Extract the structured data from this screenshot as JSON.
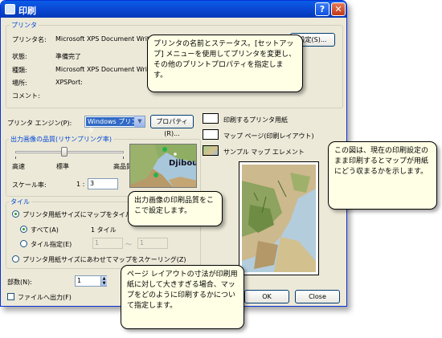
{
  "window": {
    "title": "印刷"
  },
  "printer": {
    "group_title": "プリンタ",
    "name_label": "プリンタ名:",
    "name_value": "Microsoft XPS Document Writer",
    "status_label": "状態:",
    "status_value": "準備完了",
    "type_label": "種類:",
    "type_value": "Microsoft XPS Document Writer",
    "location_label": "場所:",
    "location_value": "XPSPort:",
    "comment_label": "コメント:",
    "settings_button": "設定(S)..."
  },
  "engine": {
    "label": "プリンタ エンジン(P):",
    "value": "Windows プリンタ",
    "properties_button": "プロパティ(R)..."
  },
  "quality": {
    "group_title": "出力画像の品質(リサンプリング率)",
    "low": "高速",
    "normal": "標準",
    "high": "高品質",
    "scale_label": "スケール率:",
    "scale_prefix": "1 :",
    "scale_value": "3",
    "preview_label": "Djibouti"
  },
  "tile": {
    "group_title": "タイル",
    "option1": "プリンタ用紙サイズにマップをタイル分割(T)",
    "all_label": "すべて(A)",
    "all_count": "1 タイル",
    "specify_label": "タイル指定(E)",
    "from_value": "1",
    "to_value": "1",
    "option2": "プリンタ用紙サイズにあわせてマップをスケーリング(Z)"
  },
  "copies": {
    "label": "部数(N):",
    "value": "1"
  },
  "print_to_file": {
    "label": "ファイルへ出力(F)"
  },
  "legend": {
    "paper": "印刷するプリンタ用紙",
    "map_page": "マップ ページ(印刷レイアウト)",
    "sample": "サンプル マップ エレメント"
  },
  "buttons": {
    "ok": "OK",
    "close": "Close"
  },
  "callouts": {
    "printer_status": "プリンタの名前とステータス。[セットアップ] メニューを使用してプリンタを変更し、その他のプリントプロパティを指定します。",
    "preview": "この図は、現在の印刷設定のまま印刷するとマップが用紙にどう収まるかを示します。",
    "quality": "出力画像の印刷品質をここで設定します。",
    "tiling": "ページ レイアウトの寸法が印刷用紙に対して大きすぎる場合、マップをどのように印刷するかについて指定します。"
  }
}
